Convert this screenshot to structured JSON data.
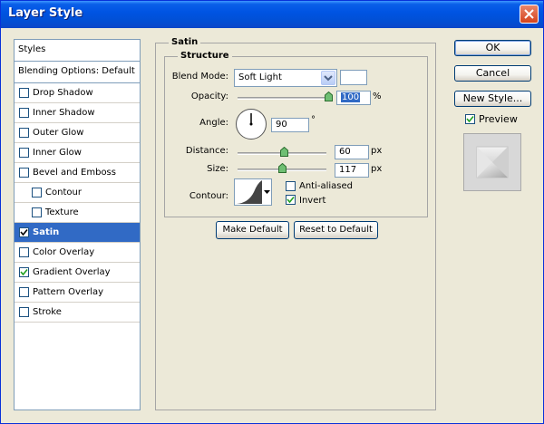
{
  "window": {
    "title": "Layer Style"
  },
  "styles_list": {
    "header": "Styles",
    "blending": "Blending Options: Default",
    "items": [
      {
        "label": "Drop Shadow",
        "checked": false,
        "indent": false,
        "selected": false
      },
      {
        "label": "Inner Shadow",
        "checked": false,
        "indent": false,
        "selected": false
      },
      {
        "label": "Outer Glow",
        "checked": false,
        "indent": false,
        "selected": false
      },
      {
        "label": "Inner Glow",
        "checked": false,
        "indent": false,
        "selected": false
      },
      {
        "label": "Bevel and Emboss",
        "checked": false,
        "indent": false,
        "selected": false
      },
      {
        "label": "Contour",
        "checked": false,
        "indent": true,
        "selected": false
      },
      {
        "label": "Texture",
        "checked": false,
        "indent": true,
        "selected": false
      },
      {
        "label": "Satin",
        "checked": true,
        "indent": false,
        "selected": true
      },
      {
        "label": "Color Overlay",
        "checked": false,
        "indent": false,
        "selected": false
      },
      {
        "label": "Gradient Overlay",
        "checked": true,
        "indent": false,
        "selected": false
      },
      {
        "label": "Pattern Overlay",
        "checked": false,
        "indent": false,
        "selected": false
      },
      {
        "label": "Stroke",
        "checked": false,
        "indent": false,
        "selected": false
      }
    ]
  },
  "satin": {
    "title": "Satin",
    "structure_title": "Structure",
    "blend_mode_label": "Blend Mode:",
    "blend_mode_value": "Soft Light",
    "opacity_label": "Opacity:",
    "opacity_value": "100",
    "opacity_unit": "%",
    "opacity_level": 1.0,
    "angle_label": "Angle:",
    "angle_value": "90",
    "angle_unit": "°",
    "distance_label": "Distance:",
    "distance_value": "60",
    "distance_unit": "px",
    "distance_level": 0.52,
    "size_label": "Size:",
    "size_value": "117",
    "size_unit": "px",
    "size_level": 0.5,
    "contour_label": "Contour:",
    "anti_aliased_label": "Anti-aliased",
    "anti_aliased_checked": false,
    "invert_label": "Invert",
    "invert_checked": true,
    "make_default_label": "Make Default",
    "reset_default_label": "Reset to Default"
  },
  "buttons": {
    "ok": "OK",
    "cancel": "Cancel",
    "new_style": "New Style...",
    "preview_label": "Preview",
    "preview_checked": true
  },
  "colors": {
    "selection": "#316ac5",
    "titlebar": "#0054e3",
    "dialog_bg": "#ece9d8"
  }
}
